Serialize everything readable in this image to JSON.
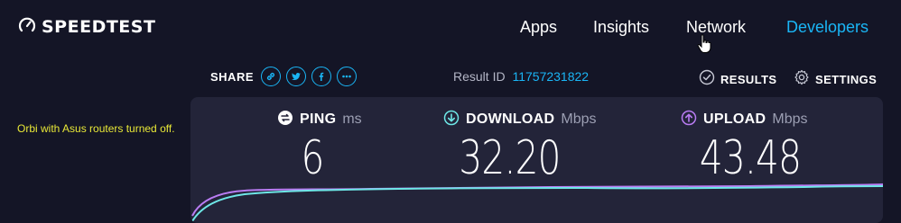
{
  "logo": {
    "text": "SPEEDTEST"
  },
  "nav": {
    "items": [
      {
        "label": "Apps"
      },
      {
        "label": "Insights"
      },
      {
        "label": "Network"
      },
      {
        "label": "Developers",
        "active": true
      }
    ]
  },
  "share": {
    "label": "SHARE",
    "buttons": [
      "link-icon",
      "twitter-icon",
      "facebook-icon",
      "more-icon"
    ]
  },
  "result": {
    "label": "Result ID",
    "id": "11757231822"
  },
  "actions": {
    "results": "RESULTS",
    "settings": "SETTINGS"
  },
  "note": "Orbi with Asus routers turned off.",
  "metrics": {
    "ping": {
      "name": "PING",
      "unit": "ms",
      "value": "6"
    },
    "download": {
      "name": "DOWNLOAD",
      "unit": "Mbps",
      "value": "32.20",
      "color": "#6ee7e7"
    },
    "upload": {
      "name": "UPLOAD",
      "unit": "Mbps",
      "value": "43.48",
      "color": "#b97cf3"
    }
  },
  "colors": {
    "accent": "#1ab5f5",
    "background": "#141526",
    "panel": "#232439",
    "note": "#e8e837"
  }
}
